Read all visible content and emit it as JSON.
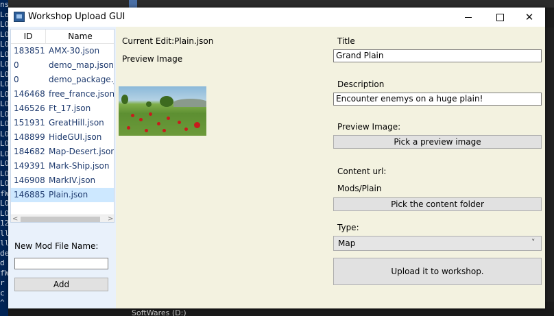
{
  "window": {
    "title": "Workshop Upload GUI",
    "min_label": "",
    "max_label": "",
    "close_label": "✕"
  },
  "list": {
    "headers": {
      "id": "ID",
      "name": "Name"
    },
    "rows": [
      {
        "id": "183851",
        "name": "AMX-30.json"
      },
      {
        "id": "0",
        "name": "demo_map.json"
      },
      {
        "id": "0",
        "name": "demo_package.js"
      },
      {
        "id": "146468",
        "name": "free_france.json"
      },
      {
        "id": "146526",
        "name": "Ft_17.json"
      },
      {
        "id": "151931",
        "name": "GreatHill.json"
      },
      {
        "id": "148899",
        "name": "HideGUI.json"
      },
      {
        "id": "184682",
        "name": "Map-Desert.json"
      },
      {
        "id": "149391",
        "name": "Mark-Ship.json"
      },
      {
        "id": "146908",
        "name": "MarkIV.json"
      },
      {
        "id": "146885",
        "name": "Plain.json"
      }
    ],
    "selected_index": 10,
    "scroll_left": "<",
    "scroll_right": ">"
  },
  "new_mod": {
    "label": "New Mod File Name:",
    "value": "",
    "add_label": "Add"
  },
  "main": {
    "current_edit": "Current Edit:Plain.json",
    "preview_label": "Preview Image",
    "title_label": "Title",
    "title_value": "Grand Plain",
    "description_label": "Description",
    "description_value": "Encounter enemys on a huge plain!",
    "preview_image_label": "Preview Image:",
    "pick_image_button": "Pick a preview image",
    "content_url_label": "Content url:",
    "content_path": "Mods/Plain",
    "pick_folder_button": "Pick the content folder",
    "type_label": "Type:",
    "type_value": "Map",
    "type_arrow": "˅",
    "upload_button": "Upload it to workshop."
  },
  "background": {
    "taskbar_item": "SoftWares (D:)"
  },
  "colors": {
    "main_bg": "#f3f2e0",
    "left_bg": "#e9f1fb",
    "selection": "#cde8ff",
    "button": "#e1e1e1"
  }
}
